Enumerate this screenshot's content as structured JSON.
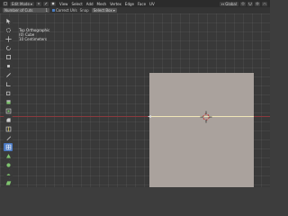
{
  "header": {
    "mode_label": "Edit Mode",
    "menu": [
      "View",
      "Select",
      "Add",
      "Mesh",
      "Vertex",
      "Edge",
      "Face",
      "UV"
    ],
    "global_label": "Global"
  },
  "tool_settings": {
    "number_of_cuts_label": "Number of Cuts",
    "number_of_cuts_value": "1",
    "correct_uvs_label": "Correct UVs",
    "snap_label": "Snap",
    "select_box_label": "Select Box"
  },
  "viewport": {
    "info_lines": [
      "Top Orthographic",
      "(0) Cube",
      "10 Centimeters"
    ]
  },
  "colors": {
    "accent": "#4a78c2",
    "x_axis": "#8a3a3e",
    "plane": "#aaa29d",
    "edge": "#f0e6b8"
  }
}
